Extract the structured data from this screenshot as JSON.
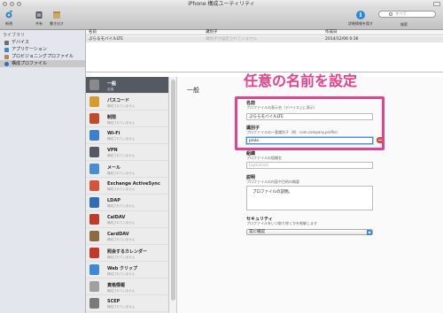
{
  "window": {
    "title": "iPhone 構成ユーティリティ"
  },
  "toolbar": {
    "new_label": "新規",
    "share_label": "共有",
    "export_label": "書き出す",
    "details_label": "詳細情報を隠す",
    "search_placeholder": "すべて",
    "search_label": "検索"
  },
  "sidebar": {
    "heading": "ライブラリ",
    "items": [
      {
        "label": "デバイス",
        "color": "#6f6f6f"
      },
      {
        "label": "アプリケーション",
        "color": "#3d86d6"
      },
      {
        "label": "プロビジョニングプロファイル",
        "color": "#b08a4a"
      },
      {
        "label": "構成プロファイル",
        "color": "#2e6fc0"
      }
    ]
  },
  "profile_list": {
    "columns": [
      "名前",
      "識別子",
      "作成日"
    ],
    "rows": [
      {
        "name": "ぷらるモバイルLTE",
        "identifier": "識別子が設定されていません",
        "created": "2014/12/06 0:36"
      }
    ]
  },
  "payloads": [
    {
      "title": "一般",
      "subtitle": "必須",
      "icon": "general-icon",
      "color": "#8a8a8a",
      "selected": true
    },
    {
      "title": "パスコード",
      "subtitle": "構成されていません",
      "icon": "key-icon",
      "color": "#d89a2a"
    },
    {
      "title": "制限",
      "subtitle": "構成されていません",
      "icon": "restrictions-icon",
      "color": "#c14a2a"
    },
    {
      "title": "Wi-Fi",
      "subtitle": "構成されていません",
      "icon": "wifi-icon",
      "color": "#3a7fd0"
    },
    {
      "title": "VPN",
      "subtitle": "構成されていません",
      "icon": "vpn-icon",
      "color": "#555a62"
    },
    {
      "title": "メール",
      "subtitle": "構成されていません",
      "icon": "mail-icon",
      "color": "#4a8bd6"
    },
    {
      "title": "Exchange ActiveSync",
      "subtitle": "構成されていません",
      "icon": "exchange-icon",
      "color": "#d9533a"
    },
    {
      "title": "LDAP",
      "subtitle": "構成されていません",
      "icon": "ldap-icon",
      "color": "#2f6db8"
    },
    {
      "title": "CalDAV",
      "subtitle": "構成されていません",
      "icon": "calendar-icon",
      "color": "#c03a2a"
    },
    {
      "title": "CardDAV",
      "subtitle": "構成されていません",
      "icon": "contacts-icon",
      "color": "#8d6b3f"
    },
    {
      "title": "照会するカレンダー",
      "subtitle": "構成されていません",
      "icon": "subscribed-calendar-icon",
      "color": "#c03a2a"
    },
    {
      "title": "Web クリップ",
      "subtitle": "構成されていません",
      "icon": "webclip-icon",
      "color": "#3a8ad8"
    },
    {
      "title": "資格情報",
      "subtitle": "構成されていません",
      "icon": "credentials-icon",
      "color": "#a0a0a0"
    },
    {
      "title": "SCEP",
      "subtitle": "構成されていません",
      "icon": "scep-icon",
      "color": "#7a7a7a"
    }
  ],
  "editor": {
    "section_title": "一般",
    "annotation": "任意の名前を設定",
    "fields": {
      "name": {
        "label": "名前",
        "description": "プロファイルの表示名（デバイス上に表示）",
        "value": "ぷららモバイルLTE"
      },
      "identifier": {
        "label": "識別子",
        "description": "プロファイルの一意識別子（例：com.company.profile）",
        "value": "plala"
      },
      "organization": {
        "label": "組織",
        "description": "プロファイルの組織名",
        "placeholder": "[optional]"
      },
      "description": {
        "label": "説明",
        "description": "プロファイルの内容や目的の概要",
        "value": "プロファイルの説明。"
      },
      "security": {
        "label": "セキュリティ",
        "description": "プロファイルをいつ取り除くかを制御します",
        "value": "常に確認"
      }
    }
  }
}
